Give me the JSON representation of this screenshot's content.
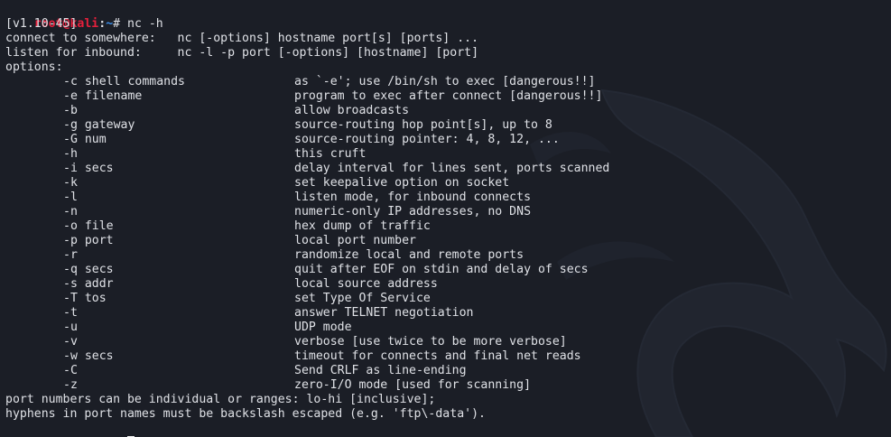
{
  "prompt": {
    "user": "root",
    "at": "@",
    "host": "kali",
    "sep": ":",
    "path": "~",
    "symbol": "# "
  },
  "command": "nc -h",
  "version": "[v1.10-45]",
  "usage": [
    "connect to somewhere:   nc [-options] hostname port[s] [ports] ...",
    "listen for inbound:     nc -l -p port [-options] [hostname] [port]"
  ],
  "options_header": "options:",
  "options": [
    {
      "flag": "-c shell commands",
      "desc": "as `-e'; use /bin/sh to exec [dangerous!!]"
    },
    {
      "flag": "-e filename",
      "desc": "program to exec after connect [dangerous!!]"
    },
    {
      "flag": "-b",
      "desc": "allow broadcasts"
    },
    {
      "flag": "-g gateway",
      "desc": "source-routing hop point[s], up to 8"
    },
    {
      "flag": "-G num",
      "desc": "source-routing pointer: 4, 8, 12, ..."
    },
    {
      "flag": "-h",
      "desc": "this cruft"
    },
    {
      "flag": "-i secs",
      "desc": "delay interval for lines sent, ports scanned"
    },
    {
      "flag": "-k",
      "desc": "set keepalive option on socket"
    },
    {
      "flag": "-l",
      "desc": "listen mode, for inbound connects"
    },
    {
      "flag": "-n",
      "desc": "numeric-only IP addresses, no DNS"
    },
    {
      "flag": "-o file",
      "desc": "hex dump of traffic"
    },
    {
      "flag": "-p port",
      "desc": "local port number"
    },
    {
      "flag": "-r",
      "desc": "randomize local and remote ports"
    },
    {
      "flag": "-q secs",
      "desc": "quit after EOF on stdin and delay of secs"
    },
    {
      "flag": "-s addr",
      "desc": "local source address"
    },
    {
      "flag": "-T tos",
      "desc": "set Type Of Service"
    },
    {
      "flag": "-t",
      "desc": "answer TELNET negotiation"
    },
    {
      "flag": "-u",
      "desc": "UDP mode"
    },
    {
      "flag": "-v",
      "desc": "verbose [use twice to be more verbose]"
    },
    {
      "flag": "-w secs",
      "desc": "timeout for connects and final net reads"
    },
    {
      "flag": "-C",
      "desc": "Send CRLF as line-ending"
    },
    {
      "flag": "-z",
      "desc": "zero-I/O mode [used for scanning]"
    }
  ],
  "footer": [
    "port numbers can be individual or ranges: lo-hi [inclusive];",
    "hyphens in port names must be backslash escaped (e.g. 'ftp\\-data')."
  ],
  "colors": {
    "background": "#1b1e26",
    "text": "#dfe1e6",
    "user": "#e5203c",
    "path": "#3b8eea"
  },
  "icons": {
    "background_art": "kali-dragon-icon",
    "cursor": "block-cursor"
  }
}
